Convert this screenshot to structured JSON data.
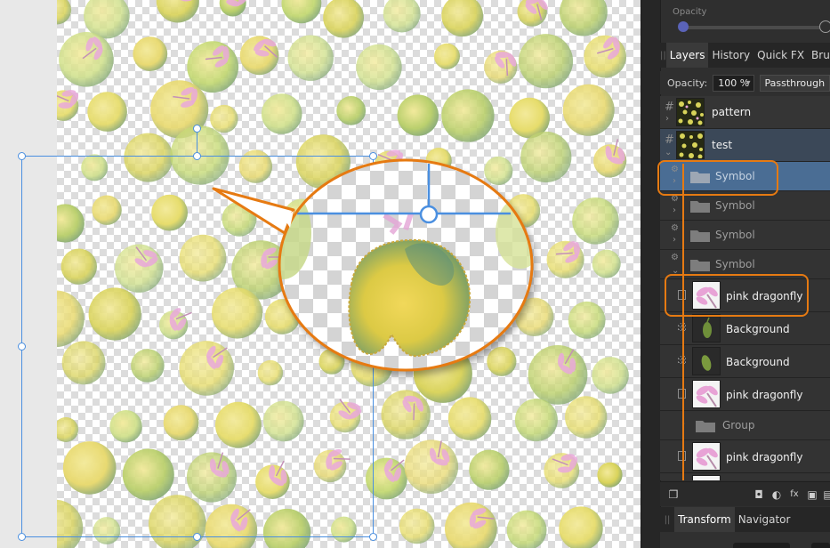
{
  "top_panel": {
    "opacity_label": "Opacity"
  },
  "tabs_top": [
    {
      "label": "Layers",
      "active": true
    },
    {
      "label": "History",
      "active": false
    },
    {
      "label": "Quick FX",
      "active": false
    },
    {
      "label": "Brushes",
      "active": false
    }
  ],
  "layer_options": {
    "opacity_label": "Opacity:",
    "opacity_value": "100 %",
    "blend_mode": "Passthrough"
  },
  "layers": [
    {
      "name": "pattern",
      "kind": "pattern"
    },
    {
      "name": "test",
      "kind": "pattern"
    },
    {
      "name": "Symbol",
      "kind": "symbol",
      "selected": true
    },
    {
      "name": "Symbol",
      "kind": "symbol"
    },
    {
      "name": "Symbol",
      "kind": "symbol"
    },
    {
      "name": "Symbol",
      "kind": "symbol"
    },
    {
      "name": "pink dragonfly",
      "kind": "dragonfly"
    },
    {
      "name": "Background",
      "kind": "bud"
    },
    {
      "name": "Background",
      "kind": "bud"
    },
    {
      "name": "pink dragonfly",
      "kind": "dragonfly"
    },
    {
      "name": "Group",
      "kind": "group"
    },
    {
      "name": "pink dragonfly",
      "kind": "dragonfly"
    }
  ],
  "tabs_bottom": [
    {
      "label": "Transform",
      "active": true
    },
    {
      "label": "Navigator",
      "active": false
    }
  ],
  "colors": {
    "accent_orange": "#e67a12",
    "selection_blue": "#4a8fe0",
    "selected_layer": "#4a6d94"
  }
}
